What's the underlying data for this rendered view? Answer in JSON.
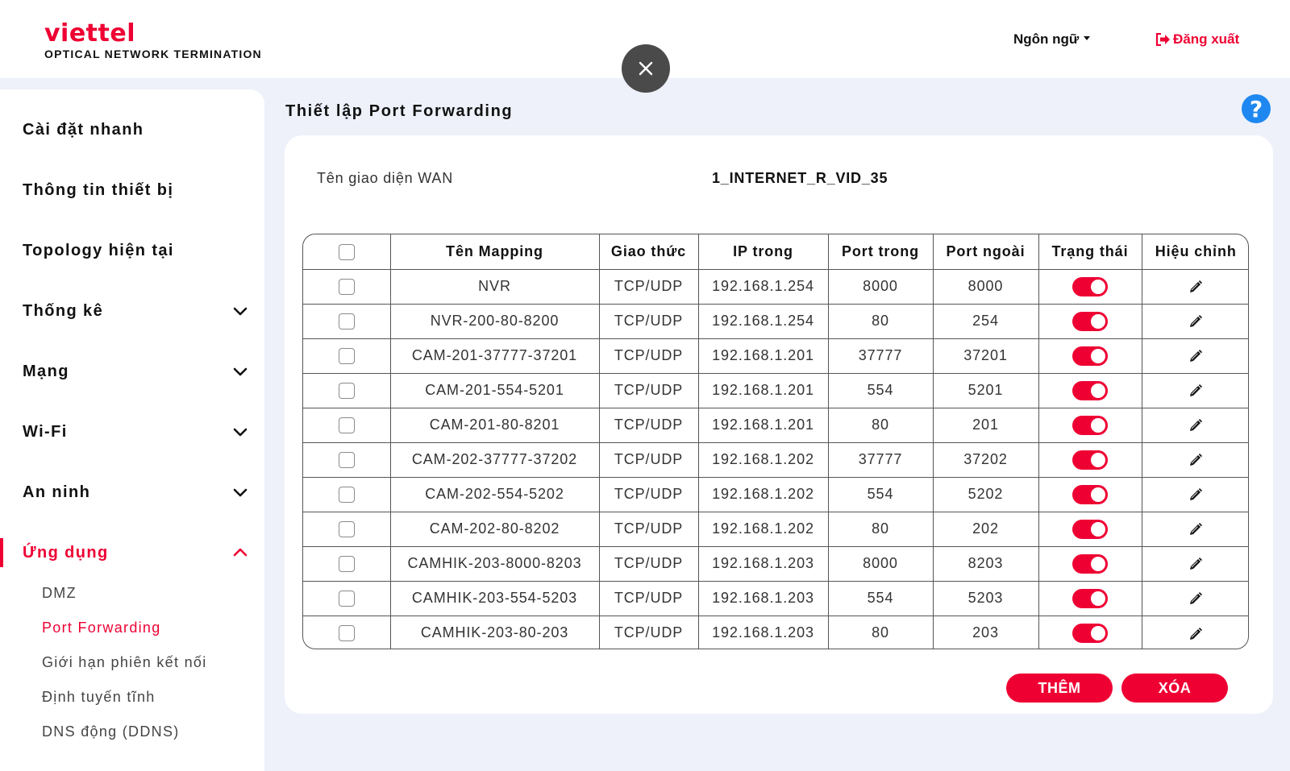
{
  "header": {
    "brand": "viettel",
    "subtitle": "OPTICAL NETWORK TERMINATION",
    "language_label": "Ngôn ngữ",
    "logout_label": "Đăng xuất"
  },
  "sidebar": {
    "items": [
      {
        "label": "Cài đặt nhanh"
      },
      {
        "label": "Thông tin thiết bị"
      },
      {
        "label": "Topology hiện tại"
      },
      {
        "label": "Thống kê"
      },
      {
        "label": "Mạng"
      },
      {
        "label": "Wi-Fi"
      },
      {
        "label": "An ninh"
      },
      {
        "label": "Ứng dụng"
      }
    ],
    "subitems": [
      {
        "label": "DMZ"
      },
      {
        "label": "Port Forwarding"
      },
      {
        "label": "Giới hạn phiên kết nối"
      },
      {
        "label": "Định tuyến tĩnh"
      },
      {
        "label": "DNS động (DDNS)"
      }
    ]
  },
  "main": {
    "title": "Thiết lập Port Forwarding",
    "wan_label": "Tên giao diện WAN",
    "wan_value": "1_INTERNET_R_VID_35",
    "table": {
      "headers": [
        "Tên Mapping",
        "Giao thức",
        "IP trong",
        "Port trong",
        "Port ngoài",
        "Trạng thái",
        "Hiệu chỉnh"
      ],
      "rows": [
        {
          "name": "NVR",
          "protocol": "TCP/UDP",
          "ip": "192.168.1.254",
          "port_in": "8000",
          "port_out": "8000"
        },
        {
          "name": "NVR-200-80-8200",
          "protocol": "TCP/UDP",
          "ip": "192.168.1.254",
          "port_in": "80",
          "port_out": "254"
        },
        {
          "name": "CAM-201-37777-37201",
          "protocol": "TCP/UDP",
          "ip": "192.168.1.201",
          "port_in": "37777",
          "port_out": "37201"
        },
        {
          "name": "CAM-201-554-5201",
          "protocol": "TCP/UDP",
          "ip": "192.168.1.201",
          "port_in": "554",
          "port_out": "5201"
        },
        {
          "name": "CAM-201-80-8201",
          "protocol": "TCP/UDP",
          "ip": "192.168.1.201",
          "port_in": "80",
          "port_out": "201"
        },
        {
          "name": "CAM-202-37777-37202",
          "protocol": "TCP/UDP",
          "ip": "192.168.1.202",
          "port_in": "37777",
          "port_out": "37202"
        },
        {
          "name": "CAM-202-554-5202",
          "protocol": "TCP/UDP",
          "ip": "192.168.1.202",
          "port_in": "554",
          "port_out": "5202"
        },
        {
          "name": "CAM-202-80-8202",
          "protocol": "TCP/UDP",
          "ip": "192.168.1.202",
          "port_in": "80",
          "port_out": "202"
        },
        {
          "name": "CAMHIK-203-8000-8203",
          "protocol": "TCP/UDP",
          "ip": "192.168.1.203",
          "port_in": "8000",
          "port_out": "8203"
        },
        {
          "name": "CAMHIK-203-554-5203",
          "protocol": "TCP/UDP",
          "ip": "192.168.1.203",
          "port_in": "554",
          "port_out": "5203"
        },
        {
          "name": "CAMHIK-203-80-203",
          "protocol": "TCP/UDP",
          "ip": "192.168.1.203",
          "port_in": "80",
          "port_out": "203"
        }
      ]
    },
    "add_label": "THÊM",
    "delete_label": "XÓA"
  },
  "colors": {
    "accent": "#ee0033",
    "background": "#eef1fa",
    "help_blue": "#1e88f0",
    "close_button": "#4a4a4a"
  },
  "icons": [
    "close-icon",
    "logout-icon",
    "chevron-down-icon",
    "chevron-up-icon",
    "help-icon",
    "pencil-icon"
  ]
}
